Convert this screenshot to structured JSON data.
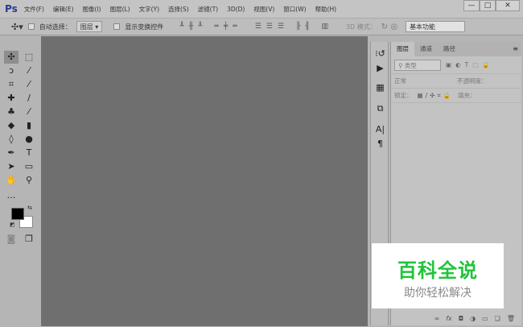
{
  "app": {
    "logo": "Ps"
  },
  "menu": [
    "文件(F)",
    "编辑(E)",
    "图像(I)",
    "图层(L)",
    "文字(Y)",
    "选择(S)",
    "滤镜(T)",
    "3D(D)",
    "视图(V)",
    "窗口(W)",
    "帮助(H)"
  ],
  "window": {
    "minimize": "—",
    "maximize": "□",
    "close": "✕"
  },
  "options": {
    "auto_select_label": "自动选择：",
    "auto_select_value": "图层",
    "show_transform_label": "显示变换控件",
    "mode_3d_label": "3D 模式：",
    "workspace": "基本功能"
  },
  "colors": {
    "foreground": "#000000",
    "background": "#ffffff",
    "canvas": "#6f6f6f",
    "watermark_green": "#1fc43a"
  },
  "panel": {
    "tabs": [
      "图层",
      "通道",
      "路径"
    ],
    "filter_placeholder": "类型",
    "blend_mode": "正常",
    "opacity_label": "不透明度：",
    "lock_label": "锁定：",
    "fill_label": "填充："
  },
  "watermark": {
    "title": "百科全说",
    "subtitle": "助你轻松解决"
  }
}
